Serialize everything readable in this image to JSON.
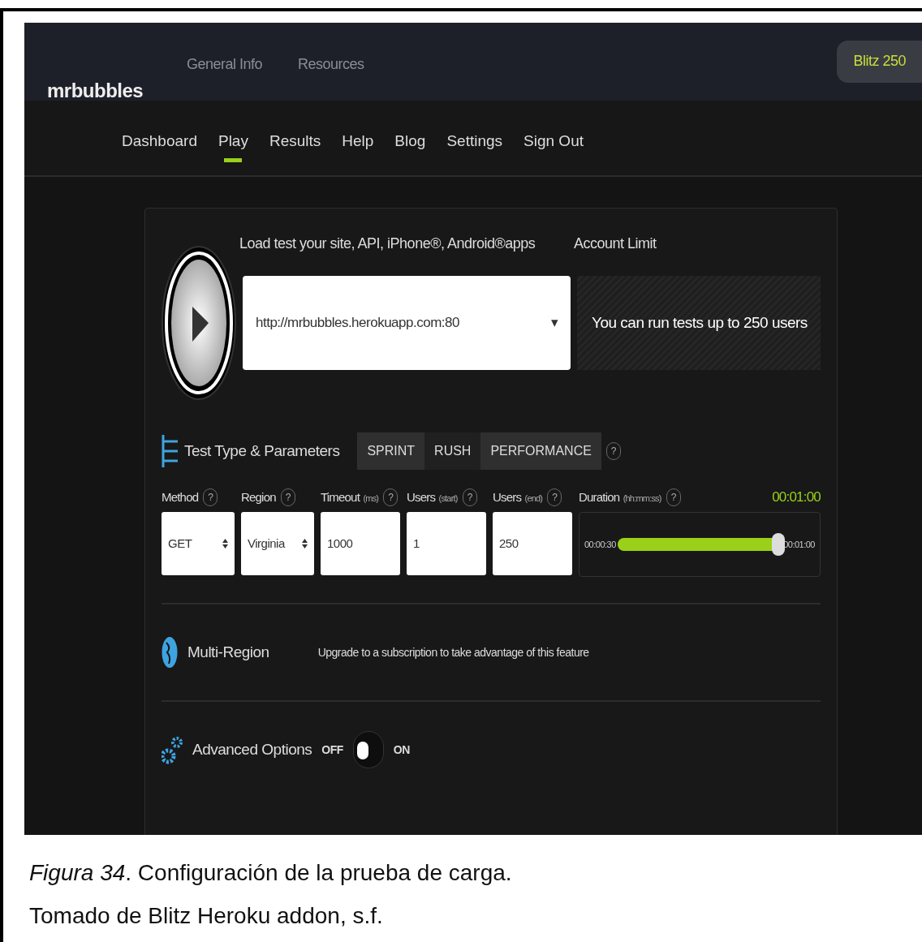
{
  "app": {
    "brand": "mrbubbles",
    "top_links": [
      "General Info",
      "Resources"
    ],
    "plan_badge": "Blitz 250"
  },
  "nav": [
    {
      "label": "Dashboard",
      "selected": false
    },
    {
      "label": "Play",
      "selected": true
    },
    {
      "label": "Results",
      "selected": false
    },
    {
      "label": "Help",
      "selected": false
    },
    {
      "label": "Blog",
      "selected": false
    },
    {
      "label": "Settings",
      "selected": false
    },
    {
      "label": "Sign Out",
      "selected": false
    }
  ],
  "target": {
    "heading": "Load test your site, API, iPhone®, Android®apps",
    "url": "http://mrbubbles.herokuapp.com:80",
    "dropdown_caret": "▾"
  },
  "account": {
    "heading": "Account Limit",
    "message": "You can run tests up to 250 users"
  },
  "test_type": {
    "title": "Test Type & Parameters",
    "help": "?",
    "tabs": [
      {
        "label": "SPRINT",
        "selected": false
      },
      {
        "label": "RUSH",
        "selected": true
      },
      {
        "label": "PERFORMANCE",
        "selected": false
      }
    ]
  },
  "params": [
    {
      "kind": "select",
      "label": "Method",
      "value": "GET"
    },
    {
      "kind": "select",
      "label": "Region",
      "value": "Virginia"
    },
    {
      "kind": "input",
      "label": "Timeout",
      "unit": "(ms)",
      "value": "1000"
    },
    {
      "kind": "input",
      "label": "Users",
      "unit": "(start)",
      "value": "1"
    },
    {
      "kind": "input",
      "label": "Users",
      "unit": "(end)",
      "value": "250"
    }
  ],
  "duration": {
    "label": "Duration",
    "unit": "(hh:mm:ss)",
    "current": "00:01:00",
    "min": "00:00:30",
    "max": "00:01:00",
    "level": 1
  },
  "multi_region": {
    "title": "Multi-Region",
    "note": "Upgrade to a subscription to take advantage of this feature"
  },
  "advanced": {
    "title": "Advanced Options",
    "off_label": "OFF",
    "on_label": "ON",
    "on": false
  },
  "caption": {
    "figure": "*Figura 34*. Configuración de la prueba de carga.",
    "source": "Tomado de Blitz Heroku addon, s.f."
  }
}
